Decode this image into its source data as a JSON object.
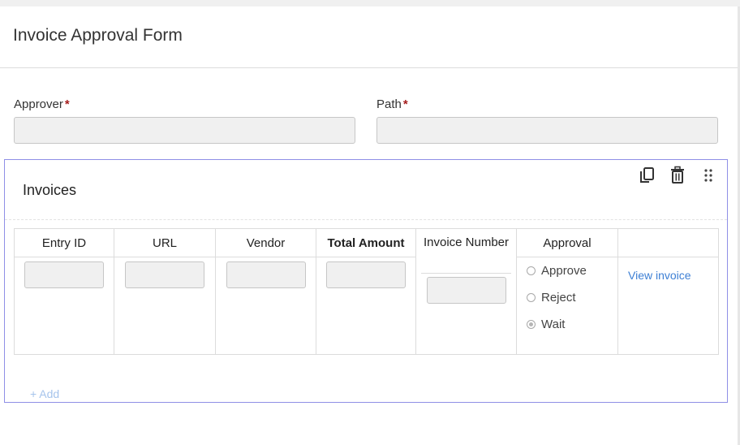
{
  "page": {
    "title": "Invoice Approval Form"
  },
  "fields": {
    "approver": {
      "label": "Approver",
      "required_mark": "*",
      "value": ""
    },
    "path": {
      "label": "Path",
      "required_mark": "*",
      "value": ""
    }
  },
  "section": {
    "title": "Invoices",
    "toolbar": {
      "copy": "copy-icon",
      "delete": "trash-icon",
      "drag": "drag-handle-icon"
    },
    "columns": [
      "Entry ID",
      "URL",
      "Vendor",
      "Total Amount",
      "Invoice Number",
      "Approval",
      ""
    ],
    "row": {
      "approval_options": [
        {
          "label": "Approve",
          "selected": false
        },
        {
          "label": "Reject",
          "selected": false
        },
        {
          "label": "Wait",
          "selected": true
        }
      ],
      "link": "View invoice"
    },
    "add_label": "+ Add"
  },
  "colors": {
    "accent_border": "#8f8fe6",
    "link": "#3d7fd4",
    "required": "#a51d1d"
  }
}
